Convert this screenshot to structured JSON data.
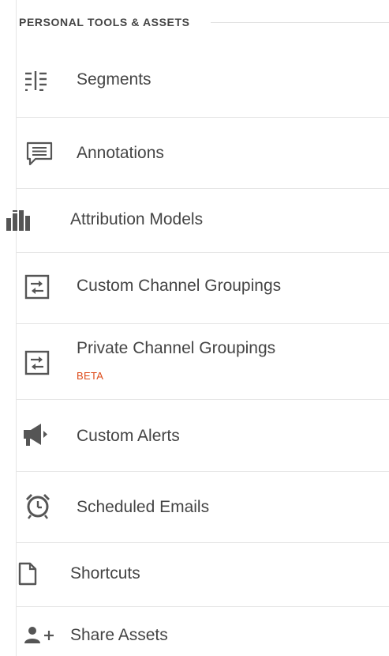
{
  "section": {
    "title": "PERSONAL TOOLS & ASSETS"
  },
  "items": [
    {
      "label": "Segments",
      "icon": "segments-icon"
    },
    {
      "label": "Annotations",
      "icon": "annotation-icon"
    },
    {
      "label": "Attribution Models",
      "icon": "attribution-models-icon"
    },
    {
      "label": "Custom Channel Groupings",
      "icon": "channel-groupings-icon"
    },
    {
      "label": "Private Channel Groupings",
      "badge": "BETA",
      "icon": "channel-groupings-icon"
    },
    {
      "label": "Custom Alerts",
      "icon": "megaphone-icon"
    },
    {
      "label": "Scheduled Emails",
      "icon": "alarm-clock-icon"
    },
    {
      "label": "Shortcuts",
      "icon": "document-icon"
    },
    {
      "label": "Share Assets",
      "icon": "add-user-icon"
    }
  ],
  "colors": {
    "text": "#444444",
    "icon": "#555555",
    "badge": "#dd4b1a",
    "divider": "#e6e6e6"
  }
}
